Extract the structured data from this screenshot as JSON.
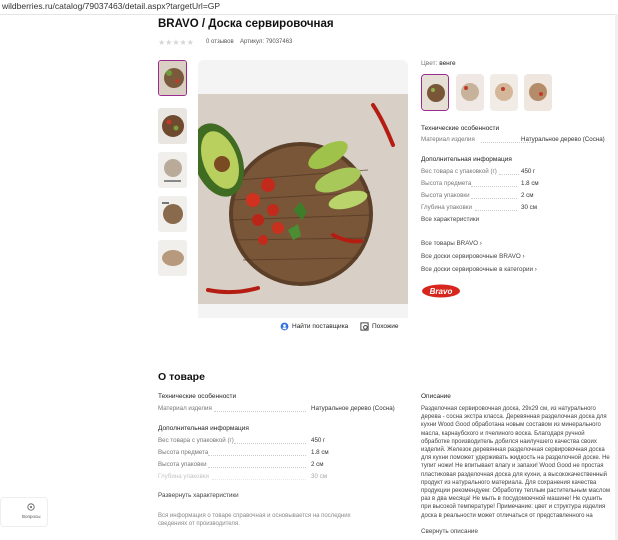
{
  "browser": {
    "url": "wildberries.ru/catalog/79037463/detail.aspx?targetUrl=GP"
  },
  "product": {
    "title": "BRAVO / Доска сервировочная",
    "reviews": "0 отзывов",
    "article": "Артикул: 79037463",
    "rating_stars": "★★★★★"
  },
  "photo_actions": {
    "supplier": "Найти поставщика",
    "similar": "Похожие"
  },
  "color": {
    "label": "Цвет:",
    "value": "венге"
  },
  "specs_top": {
    "heading": "Технические особенности",
    "rows": [
      {
        "name": "Материал изделия",
        "value": "Натуральное дерево (Сосна)"
      }
    ]
  },
  "extra_top": {
    "heading": "Дополнительная информация",
    "rows": [
      {
        "name": "Вес товара с упаковкой (г)",
        "value": "450 г"
      },
      {
        "name": "Высота предмета",
        "value": "1.8 см"
      },
      {
        "name": "Высота упаковки",
        "value": "2 см"
      },
      {
        "name": "Глубина упаковки",
        "value": "30 см"
      }
    ],
    "all_link": "Все характеристики"
  },
  "brand_links": [
    "Все товары BRAVO",
    "Все доски сервировочные BRAVO",
    "Все доски сервировочные в категории"
  ],
  "brand_logo_text": "Bravo",
  "about": {
    "title": "О товаре",
    "specs_heading": "Технические особенности",
    "specs_rows": [
      {
        "name": "Материал изделия",
        "value": "Натуральное дерево (Сосна)"
      }
    ],
    "extra_heading": "Дополнительная информация",
    "extra_rows": [
      {
        "name": "Вес товара с упаковкой (г)",
        "value": "450 г"
      },
      {
        "name": "Высота предмета",
        "value": "1.8 см"
      },
      {
        "name": "Высота упаковки",
        "value": "2 см"
      },
      {
        "name": "Глубина упаковки",
        "value": "30 см"
      }
    ],
    "expand_link": "Развернуть характеристики",
    "disclaimer": "Вся информация о товаре справочная и основывается на последних сведениях от производителя.",
    "desc_heading": "Описание",
    "description": "Разделочная сервировочная доска, 29х29 см, из натурального дерева - сосна экстра класса. Деревянная разделочная доска для кухни Wood Good обработана новым составом из минерального масла, карнаубского и пчелиного воска. Благодаря ручной обработке производитель добился наилучшего качества своих изделий. Железок деревянная разделочная сервировочная доска для кухни поможет удерживать жидкость на разделочной доске. Не тупит ножи! Не впитывает влагу и запахи! Wood Good не простая пластиковая разделочная доска для кухни, а высококачественный продукт из натурального материала. Для сохранения качества продукции рекомендуем: Обработку теплым растительным маслом раз в два месяца! Не мыть в посудомоечной машине! Не сушить при высокой температуре! Примечание: цвет и структура изделия доска в реальности может отличаться от представленного на",
    "desc_collapse": "Свернуть описание"
  },
  "left_widget": {
    "item": "Вопросы"
  }
}
